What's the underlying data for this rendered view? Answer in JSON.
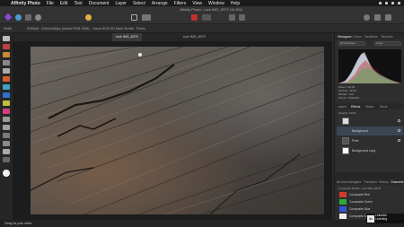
{
  "menubar": {
    "app_name": "Affinity Photo",
    "items": [
      "File",
      "Edit",
      "Text",
      "Document",
      "Layer",
      "Select",
      "Arrange",
      "Filters",
      "View",
      "Window",
      "Help"
    ]
  },
  "window": {
    "title": "Affinity Photo - rock IMG_8379 (14.8%)"
  },
  "context_bar": {
    "width_label": "Width",
    "size_label": "RGBA/8 - 5184x3456px (Adobe RGB 1998)",
    "camera_label": "Canon EOS 5D Mark III",
    "units_label": "Units",
    "units_value": "Pixels"
  },
  "tabs": [
    "rock IMG_8379",
    "rock IMG_8379"
  ],
  "panel": {
    "top_tabs": [
      "Histogram",
      "Colour",
      "Swatches",
      "Brushes"
    ],
    "channel_select": "All Channels",
    "layer_select": "Layer",
    "stats": [
      "Mean: 101.05",
      "Std Dev: 46.52",
      "Median: 100",
      "Pixels: 17915904"
    ],
    "layer_tabs": [
      "Layers",
      "Effects",
      "Styles",
      "Stock"
    ],
    "opacity_label": "Opacity: 100%",
    "layers": [
      {
        "name": "Background"
      },
      {
        "name": "Pixel"
      },
      {
        "name": "Background copy"
      }
    ],
    "bottom_tabs": [
      "Brushes",
      "Navigator",
      "Transform",
      "History",
      "Channels"
    ],
    "channels_header": "Composite RGBA - rock IMG_8379",
    "channels": [
      {
        "name": "Composite Red",
        "color": "#d63a2e"
      },
      {
        "name": "Composite Green",
        "color": "#2eaa3c"
      },
      {
        "name": "Composite Blue",
        "color": "#3355d8"
      },
      {
        "name": "Composite Alpha",
        "color": "#eeeeee"
      }
    ]
  },
  "status": {
    "text": "Drag to pan view."
  },
  "watermark": {
    "logo": "LinkedIn",
    "line1": "LinkedIn",
    "line2": "Learning"
  },
  "accent": "#4a8fe0"
}
